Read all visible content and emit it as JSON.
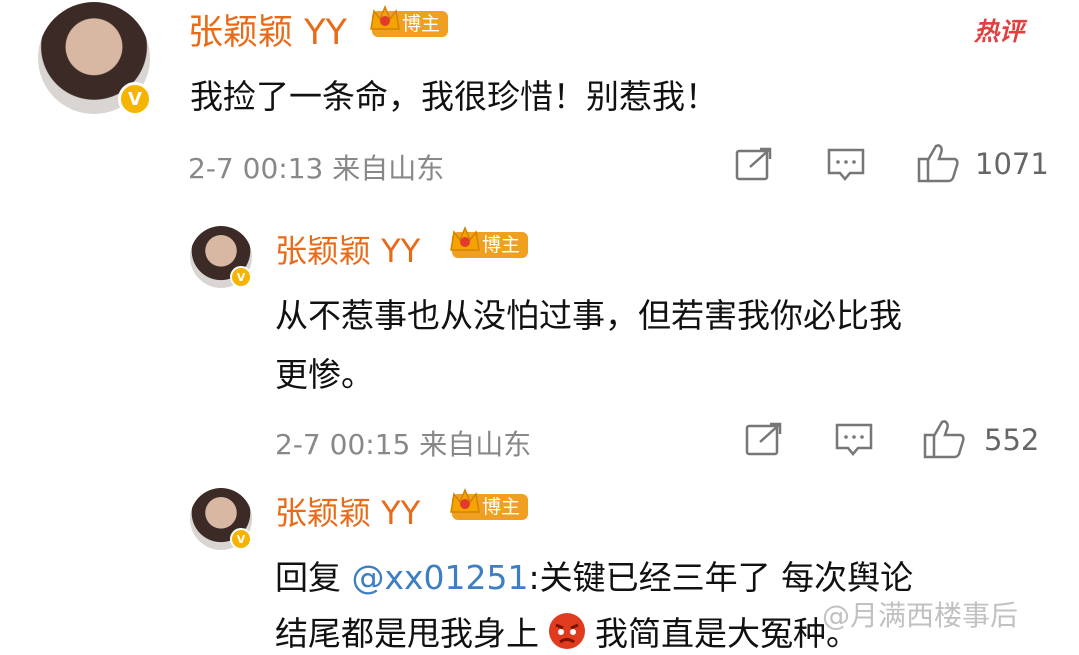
{
  "post": {
    "author": "张颖颖 YY",
    "badge": "博主",
    "hot_tag": "热评",
    "text": "我捡了一条命，我很珍惜！别惹我！",
    "meta": "2-7 00:13 来自山东",
    "likes": "1071"
  },
  "reply1": {
    "author": "张颖颖 YY",
    "badge": "博主",
    "line1": "从不惹事也从没怕过事，但若害我你必比我",
    "line2": "更惨。",
    "meta": "2-7 00:15 来自山东",
    "likes": "552"
  },
  "reply2": {
    "author": "张颖颖 YY",
    "badge": "博主",
    "prefix": "回复 ",
    "mention": "@xx01251",
    "line1_rest": ":关键已经三年了 每次舆论",
    "line2_a": "结尾都是甩我身上",
    "line2_b": "我简直是大冤种。"
  },
  "watermark": "@月满西楼事后"
}
